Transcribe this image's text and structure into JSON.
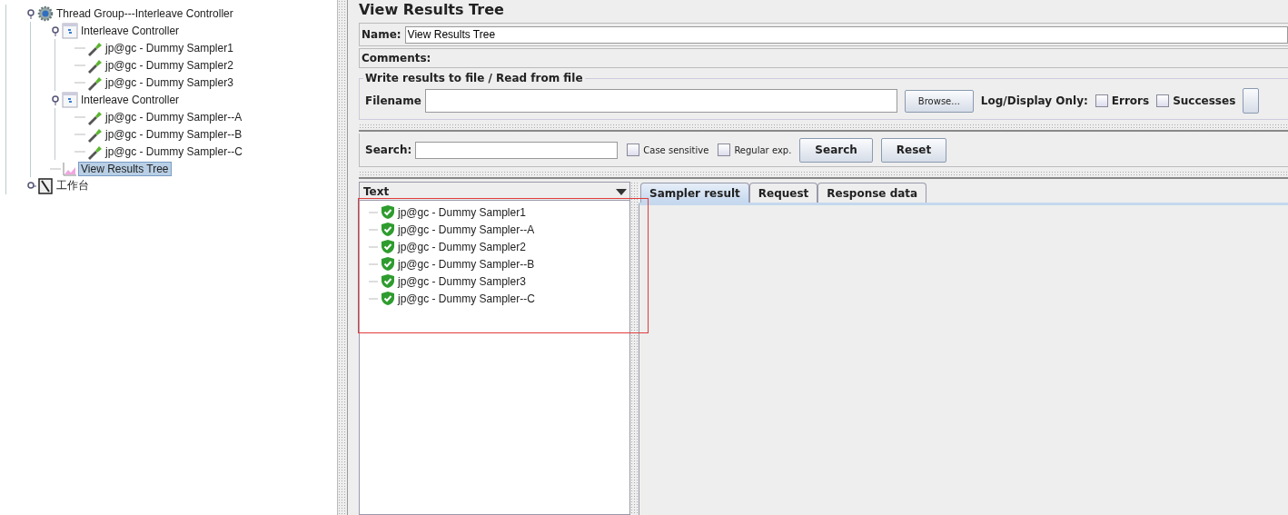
{
  "test_plan_tree": {
    "items": [
      {
        "label": "Thread Group---Interleave Controller",
        "kind": "thread-group",
        "expanded": true,
        "selected": false,
        "children": [
          {
            "label": "Interleave Controller",
            "kind": "controller",
            "expanded": true,
            "selected": false,
            "children": [
              {
                "label": "jp@gc - Dummy Sampler1",
                "kind": "sampler",
                "selected": false
              },
              {
                "label": "jp@gc - Dummy Sampler2",
                "kind": "sampler",
                "selected": false
              },
              {
                "label": "jp@gc - Dummy Sampler3",
                "kind": "sampler",
                "selected": false
              }
            ]
          },
          {
            "label": "Interleave Controller",
            "kind": "controller",
            "expanded": true,
            "selected": false,
            "children": [
              {
                "label": "jp@gc - Dummy Sampler--A",
                "kind": "sampler",
                "selected": false
              },
              {
                "label": "jp@gc - Dummy Sampler--B",
                "kind": "sampler",
                "selected": false
              },
              {
                "label": "jp@gc - Dummy Sampler--C",
                "kind": "sampler",
                "selected": false
              }
            ]
          },
          {
            "label": "View Results Tree",
            "kind": "listener",
            "selected": true
          }
        ]
      },
      {
        "label": "工作台",
        "kind": "workbench",
        "expanded": false,
        "selected": false
      }
    ]
  },
  "panel": {
    "title": "View Results Tree",
    "name_field": {
      "label": "Name:",
      "value": "View Results Tree"
    },
    "comments_field": {
      "label": "Comments:"
    },
    "file_group": {
      "title": "Write results to file / Read from file",
      "filename_label": "Filename",
      "browse_button": "Browse...",
      "log_label": "Log/Display Only:",
      "checkboxes": [
        {
          "label": "Errors",
          "checked": false
        },
        {
          "label": "Successes",
          "checked": false
        }
      ]
    },
    "search_bar": {
      "label": "Search:",
      "options": [
        {
          "label": "Case sensitive",
          "checked": false
        },
        {
          "label": "Regular exp.",
          "checked": false
        }
      ],
      "buttons": [
        "Search",
        "Reset"
      ]
    },
    "results": {
      "column_header": "Text",
      "items": [
        {
          "label": "jp@gc - Dummy Sampler1"
        },
        {
          "label": "jp@gc - Dummy Sampler--A"
        },
        {
          "label": "jp@gc - Dummy Sampler2"
        },
        {
          "label": "jp@gc - Dummy Sampler--B"
        },
        {
          "label": "jp@gc - Dummy Sampler3"
        },
        {
          "label": "jp@gc - Dummy Sampler--C"
        }
      ]
    },
    "tabs": [
      {
        "label": "Sampler result",
        "selected": true
      },
      {
        "label": "Request",
        "selected": false
      },
      {
        "label": "Response data",
        "selected": false
      }
    ],
    "highlight_box": {
      "shown": true
    }
  }
}
